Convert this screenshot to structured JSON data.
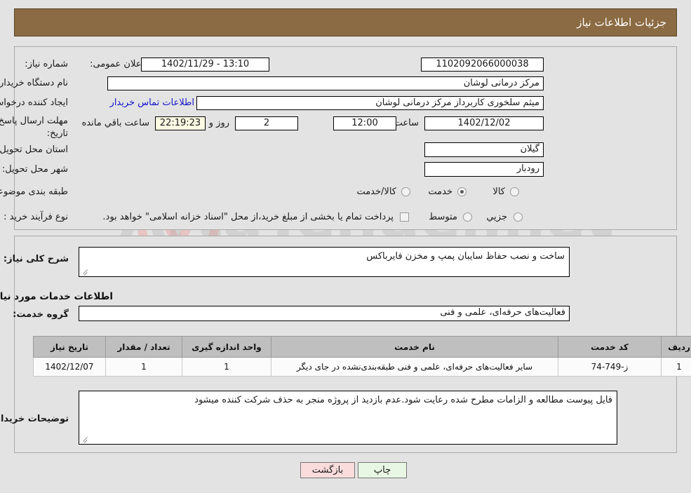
{
  "header": {
    "title": "جزئیات اطلاعات نیاز"
  },
  "watermark": {
    "text": "ArtaTender.net",
    "shield_color": "#e8c9c9"
  },
  "need_info": {
    "need_number_label": "شماره نیاز:",
    "need_number_value": "1102092066000038",
    "public_announce_label": "تاریخ و ساعت اعلان عمومی:",
    "public_announce_value": "13:10 - 1402/11/29",
    "buyer_org_label": "نام دستگاه خریدار:",
    "buyer_org_value": "مرکز درمانی لوشان",
    "buyer_org_extra_value": "",
    "creator_label": "ایجاد کننده درخواست:",
    "creator_value": "میثم سلخوری کاربرداز مرکز درمانی لوشان",
    "contact_link": "اطلاعات تماس خریدار",
    "deadline_label": "مهلت ارسال پاسخ: تا تاریخ:",
    "deadline_date": "1402/12/02",
    "deadline_hour_label": "ساعت",
    "deadline_hour_value": "12:00",
    "days_value": "2",
    "days_label": "روز و",
    "countdown_value": "22:19:23",
    "countdown_label": "ساعت باقي مانده",
    "province_label": "استان محل تحویل:",
    "province_value": "گیلان",
    "city_label": "شهر محل تحویل:",
    "city_value": "رودبار",
    "category_label": "طبقه بندی موضوعی:",
    "category_options": [
      {
        "label": "کالا",
        "selected": false
      },
      {
        "label": "خدمت",
        "selected": true
      },
      {
        "label": "کالا/خدمت",
        "selected": false
      }
    ],
    "process_label": "نوع فرآیند خرید :",
    "process_options": [
      {
        "label": "جزیي",
        "selected": false
      },
      {
        "label": "متوسط",
        "selected": false
      }
    ],
    "treasury_checkbox_label": "پرداخت تمام یا بخشی از مبلغ خرید،از محل \"اسناد خزانه اسلامی\" خواهد بود.",
    "treasury_checked": false
  },
  "main": {
    "general_desc_label": "شرح کلی نیاز:",
    "general_desc_value": "ساخت و نصب حفاظ سایبان پمپ و مخزن فایرباکس",
    "services_heading": "اطلاعات خدمات مورد نیاز",
    "service_group_label": "گروه خدمت:",
    "service_group_value": "فعالیت‌های حرفه‌ای، علمی و فنی",
    "table": {
      "headers": [
        "ردیف",
        "کد خدمت",
        "نام خدمت",
        "واحد اندازه گیری",
        "تعداد / مقدار",
        "تاریخ نیاز"
      ],
      "rows": [
        {
          "row": "1",
          "code": "ز-749-74",
          "name": "سایر فعالیت‌های حرفه‌ای، علمی و فنی طبقه‌بندی‌نشده در جای دیگر",
          "unit": "1",
          "qty": "1",
          "date": "1402/12/07"
        }
      ]
    },
    "buyer_notes_label": "توضیحات خریدار:",
    "buyer_notes_value": "فایل پیوست مطالعه و الزامات مطرح شده رعایت شود.عدم بازدید از پروژه منجر به حذف شرکت کننده میشود"
  },
  "footer": {
    "back_label": "بازگشت",
    "print_label": "چاپ"
  }
}
